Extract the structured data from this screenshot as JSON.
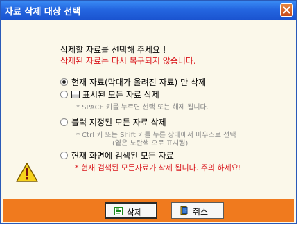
{
  "window": {
    "title": "자료 삭제 대상 선택"
  },
  "messages": {
    "line1": "삭제할 자료를 선택해 주세요 !",
    "line2": "삭제된 자료는 다시 복구되지 않습니다."
  },
  "options": [
    {
      "label": "현재 자료(막대가 올려진 자료) 만 삭제",
      "selected": true
    },
    {
      "label": "표시된 모든 자료 삭제",
      "hint": "* SPACE 키를 누르면 선택 또는 해제 됩니다.",
      "selected": false
    },
    {
      "label": "블럭 지정된 모든 자료 삭제",
      "hint1": "* Ctrl 키 또는 Shift 키를 누른 상태에서 마우스로 선택",
      "hint2": "(옅은 노란색 으로 표시됨)",
      "selected": false
    },
    {
      "label": "현재 화면에 검색된 모든 자료",
      "warning": "* 현재 검색된 모든자료가 삭제 됩니다. 주의 하세요!",
      "selected": false
    }
  ],
  "buttons": {
    "delete": "삭제",
    "cancel": "취소"
  },
  "colors": {
    "title_bar": "#2466e0",
    "background": "#fbf8ea",
    "warning_text": "#d9141a",
    "footer": "#f07a1e"
  }
}
